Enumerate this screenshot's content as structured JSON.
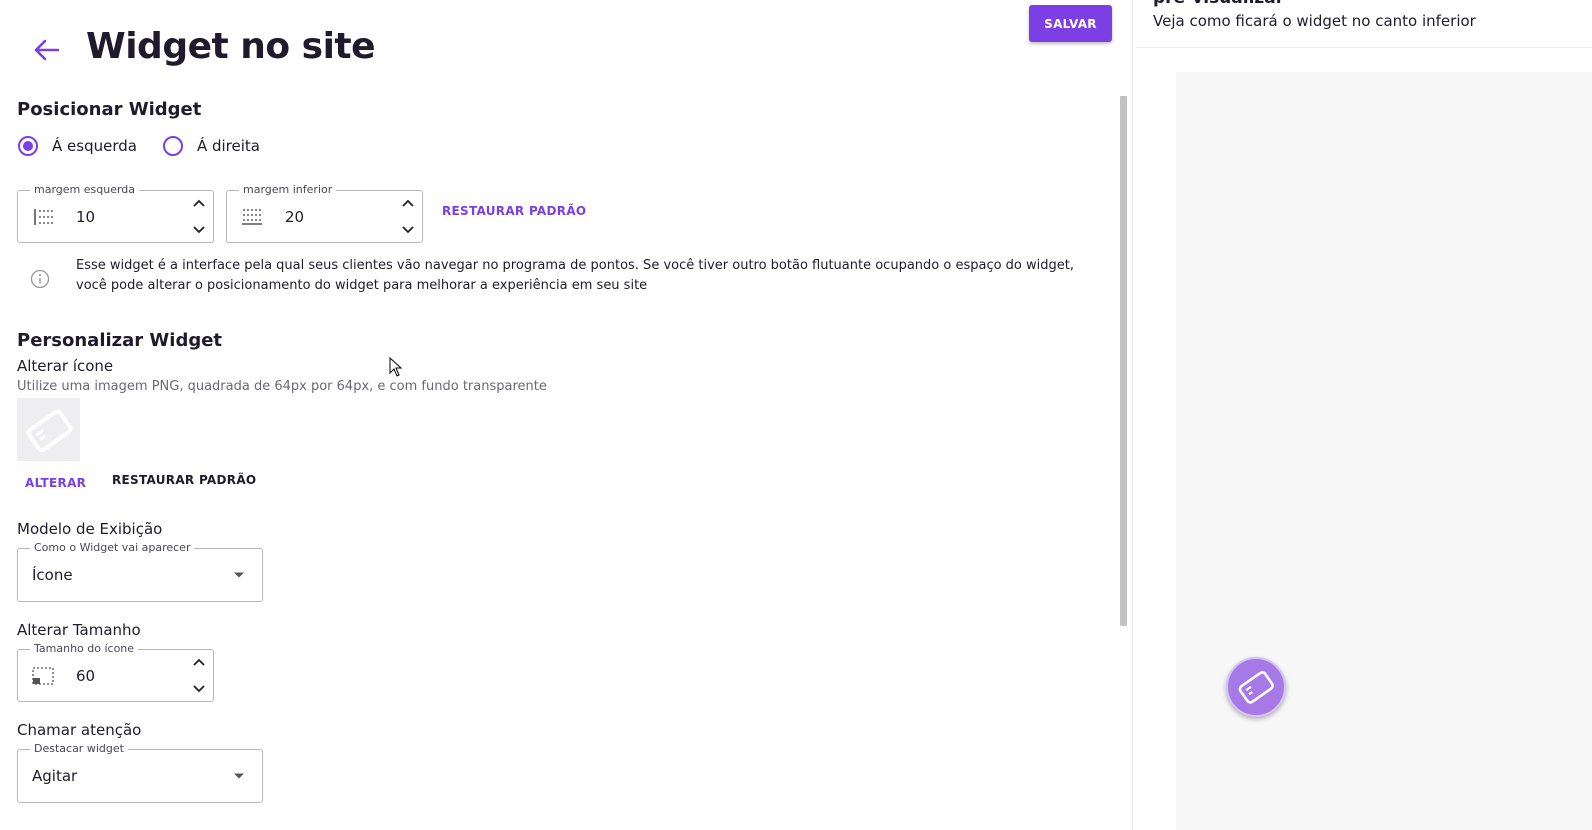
{
  "header": {
    "title": "Widget no site",
    "save_label": "SALVAR"
  },
  "position_section": {
    "title": "Posicionar Widget",
    "options": [
      {
        "label": "Á esquerda",
        "selected": true
      },
      {
        "label": "Á direita",
        "selected": false
      }
    ],
    "left_margin": {
      "legend": "margem esquerda",
      "value": "10"
    },
    "bottom_margin": {
      "legend": "margem inferior",
      "value": "20"
    },
    "restore_label": "RESTAURAR PADRÃO",
    "info": "Esse widget é a interface pela qual seus clientes vão navegar no programa de pontos. Se você tiver outro botão flutuante ocupando o espaço do widget, você pode alterar o posicionamento do widget para melhorar a experiência em seu site"
  },
  "customize_section": {
    "title": "Personalizar Widget",
    "icon": {
      "label": "Alterar ícone",
      "hint": "Utilize uma imagem PNG, quadrada de 64px por 64px, e com fundo transparente",
      "change_label": "ALTERAR",
      "restore_label": "RESTAURAR PADRÃO"
    },
    "display": {
      "label": "Modelo de Exibição",
      "legend": "Como o Widget vai aparecer",
      "value": "Ícone"
    },
    "size": {
      "label": "Alterar Tamanho",
      "legend": "Tamanho do ícone",
      "value": "60"
    },
    "attention": {
      "label": "Chamar atenção",
      "legend": "Destacar widget",
      "value": "Agitar"
    }
  },
  "preview": {
    "title": "pré-visualizar",
    "subtitle": "Veja como ficará o widget no canto inferior"
  },
  "colors": {
    "accent": "#7b3fe4",
    "widget": "#a679e6",
    "preview_bg": "#f7f7f7"
  }
}
